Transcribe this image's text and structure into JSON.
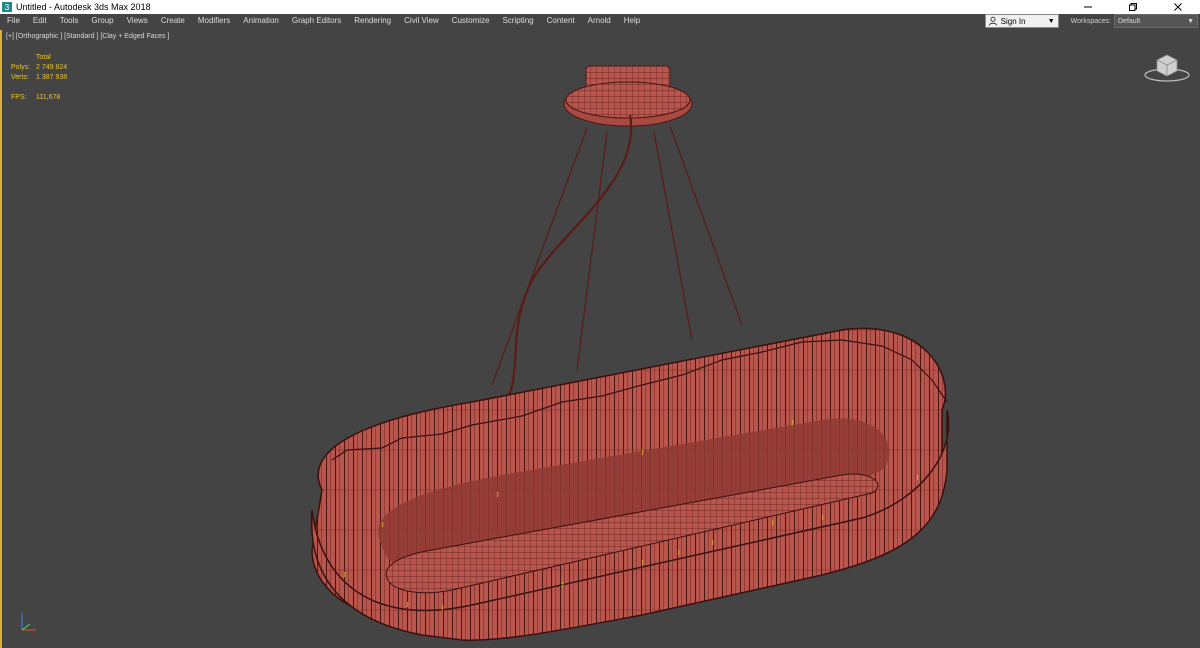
{
  "window": {
    "title": "Untitled - Autodesk 3ds Max 2018"
  },
  "menu": {
    "items": [
      "File",
      "Edit",
      "Tools",
      "Group",
      "Views",
      "Create",
      "Modifiers",
      "Animation",
      "Graph Editors",
      "Rendering",
      "Civil View",
      "Customize",
      "Scripting",
      "Content",
      "Arnold",
      "Help"
    ],
    "sign_in": "Sign In",
    "workspaces_label": "Workspaces:",
    "workspace_value": "Default"
  },
  "viewport": {
    "label": "[+] [Orthographic ] [Standard ] [Clay + Edged Faces ]",
    "stats": {
      "total_label": "Total",
      "polys_label": "Polys:",
      "polys_value": "2 749 824",
      "verts_label": "Verts:",
      "verts_value": "1 387 938",
      "fps_label": "FPS:",
      "fps_value": "111,678"
    }
  },
  "colors": {
    "model": "#b8554d",
    "model_dark": "#4a1612",
    "viewport_bg": "#444444",
    "stats_text": "#e8c52b",
    "active_border": "#d8b13c"
  },
  "icons": {
    "app": "3ds-max-icon",
    "minimize": "minimize-icon",
    "restore": "restore-icon",
    "close": "close-icon",
    "user": "user-icon",
    "dropdown": "chevron-down-icon",
    "viewcube": "viewcube-icon",
    "axis": "axis-tripod-icon"
  }
}
